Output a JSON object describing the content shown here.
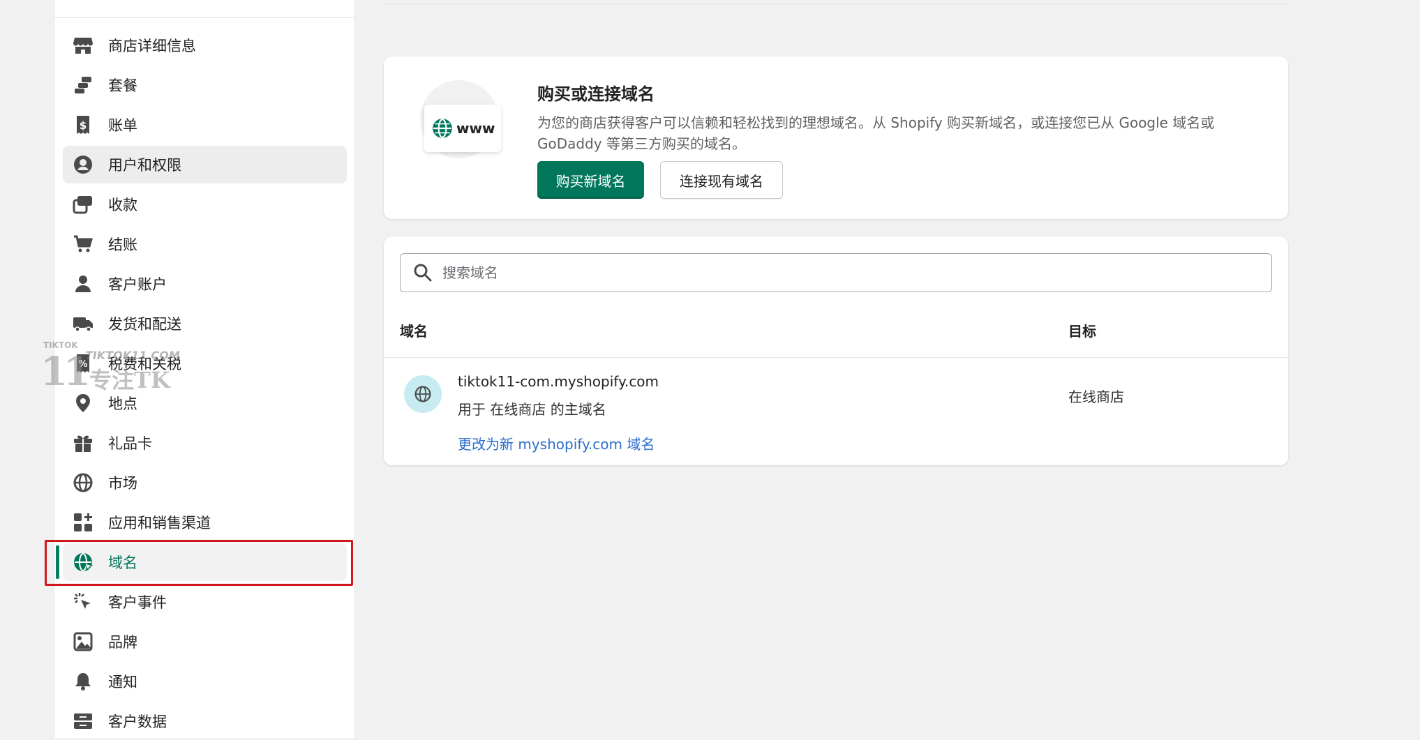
{
  "sidebar": {
    "items": [
      {
        "label": "商店详细信息",
        "icon": "store-icon"
      },
      {
        "label": "套餐",
        "icon": "plan-icon"
      },
      {
        "label": "账单",
        "icon": "billing-icon"
      },
      {
        "label": "用户和权限",
        "icon": "user-circle-icon"
      },
      {
        "label": "收款",
        "icon": "payments-icon"
      },
      {
        "label": "结账",
        "icon": "cart-icon"
      },
      {
        "label": "客户账户",
        "icon": "person-icon"
      },
      {
        "label": "发货和配送",
        "icon": "truck-icon"
      },
      {
        "label": "税费和关税",
        "icon": "tax-receipt-icon"
      },
      {
        "label": "地点",
        "icon": "location-pin-icon"
      },
      {
        "label": "礼品卡",
        "icon": "gift-icon"
      },
      {
        "label": "市场",
        "icon": "globe-outline-icon"
      },
      {
        "label": "应用和销售渠道",
        "icon": "apps-icon"
      },
      {
        "label": "域名",
        "icon": "globe-cursor-icon"
      },
      {
        "label": "客户事件",
        "icon": "click-sparkle-icon"
      },
      {
        "label": "品牌",
        "icon": "image-icon"
      },
      {
        "label": "通知",
        "icon": "bell-icon"
      },
      {
        "label": "客户数据",
        "icon": "data-box-icon"
      }
    ],
    "hovered_index": 3,
    "selected_index": 13
  },
  "watermark": {
    "small": "TIKTOK",
    "big": "11",
    "url": "TIKTOK11.COM",
    "cn": "专注TK"
  },
  "connect_card": {
    "illustration_text": "www",
    "title": "购买或连接域名",
    "description": "为您的商店获得客户可以信赖和轻松找到的理想域名。从 Shopify 购买新域名，或连接您已从 Google 域名或 GoDaddy 等第三方购买的域名。",
    "buy_button": "购买新域名",
    "connect_button": "连接现有域名"
  },
  "domains_card": {
    "search_placeholder": "搜索域名",
    "columns": {
      "domain": "域名",
      "target": "目标"
    },
    "rows": [
      {
        "domain": "tiktok11-com.myshopify.com",
        "subtitle": "用于 在线商店 的主域名",
        "target": "在线商店",
        "link": "更改为新 myshopify.com 域名"
      }
    ]
  },
  "colors": {
    "accent": "#00775b",
    "link": "#2c6ecb",
    "highlight": "#d0161d"
  }
}
